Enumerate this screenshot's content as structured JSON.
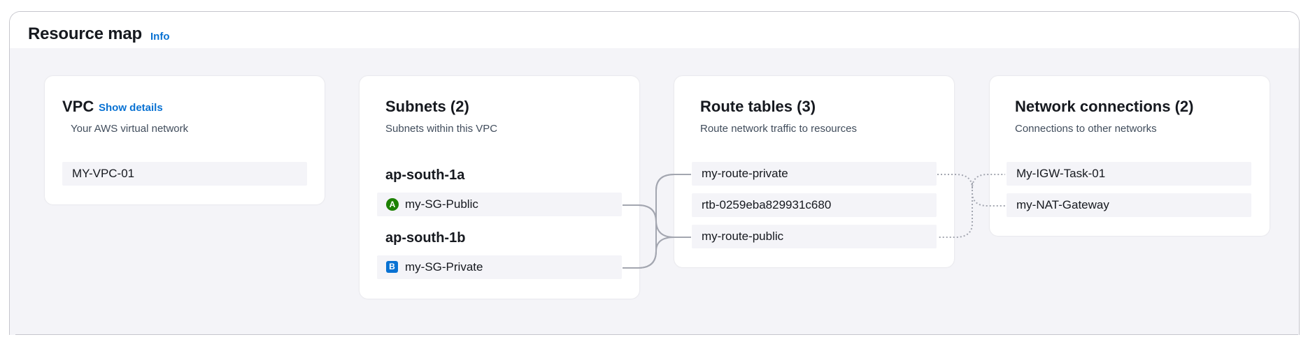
{
  "header": {
    "title": "Resource map",
    "info_label": "Info"
  },
  "vpc": {
    "title": "VPC",
    "details_label": "Show details",
    "description": "Your AWS virtual network",
    "items": [
      "MY-VPC-01"
    ]
  },
  "subnets": {
    "title": "Subnets (2)",
    "description": "Subnets within this VPC",
    "zones": [
      {
        "name": "ap-south-1a",
        "badge": "A",
        "subnet": "my-SG-Public"
      },
      {
        "name": "ap-south-1b",
        "badge": "B",
        "subnet": "my-SG-Private"
      }
    ]
  },
  "route_tables": {
    "title": "Route tables (3)",
    "description": "Route network traffic to resources",
    "items": [
      "my-route-private",
      "rtb-0259eba829931c680",
      "my-route-public"
    ]
  },
  "network_connections": {
    "title": "Network connections (2)",
    "description": "Connections to other networks",
    "items": [
      "My-IGW-Task-01",
      "my-NAT-Gateway"
    ]
  },
  "colors": {
    "link": "#0972d3",
    "badge_a": "#1d8102",
    "badge_b": "#0972d3",
    "canvas": "#f4f4f8",
    "connector": "#a3a6b0"
  }
}
